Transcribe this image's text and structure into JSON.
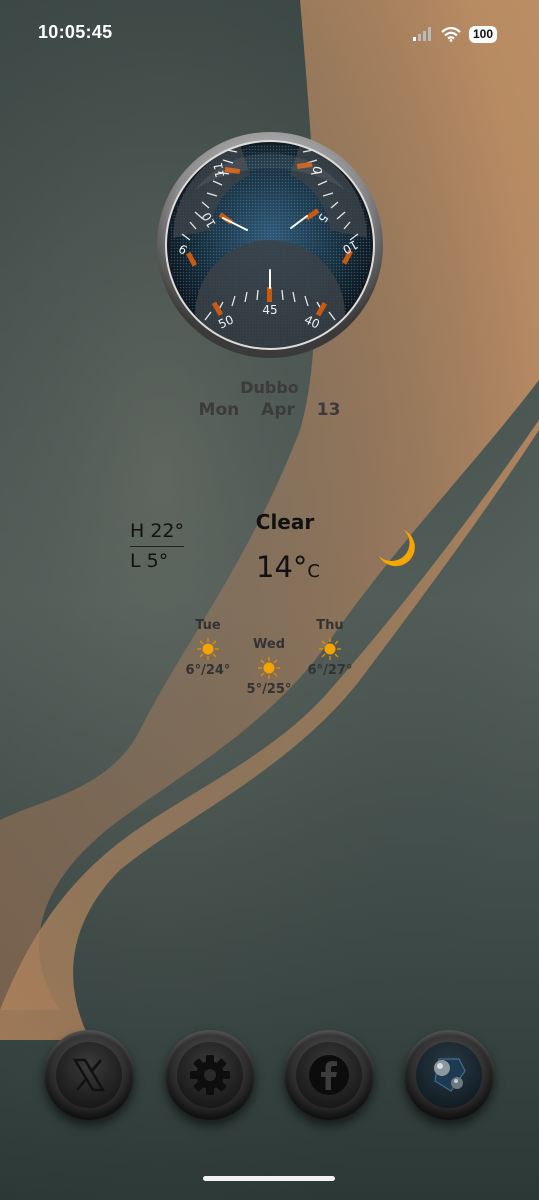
{
  "status_bar": {
    "time": "10:05:45",
    "battery": "100",
    "icons": [
      "signal-icon",
      "wifi-icon",
      "battery-icon"
    ]
  },
  "clock_widget": {
    "scale_top_right": [
      "0",
      "5",
      "10"
    ],
    "scale_top_left": [
      "11",
      "10",
      "9"
    ],
    "scale_bottom": [
      "50",
      "45",
      "40"
    ],
    "accent_color": "#c85a12"
  },
  "location": {
    "city": "Dubbo",
    "weekday": "Mon",
    "month": "Apr",
    "day": "13"
  },
  "weather": {
    "high": "H 22°",
    "low": "L  5°",
    "condition": "Clear",
    "temperature": "14°",
    "unit": "C",
    "icon": "moon-icon",
    "moon_color": "#f5a600"
  },
  "forecast": [
    {
      "day": "Tue",
      "temps": "6°/24°",
      "icon": "sun-icon"
    },
    {
      "day": "Wed",
      "temps": "5°/25°",
      "icon": "sun-icon"
    },
    {
      "day": "Thu",
      "temps": "6°/27°",
      "icon": "sun-icon"
    }
  ],
  "dock": [
    {
      "app": "x-icon"
    },
    {
      "app": "gear-icon"
    },
    {
      "app": "facebook-icon"
    },
    {
      "app": "app-icon"
    }
  ],
  "colors": {
    "wallpaper_dark": "#2f3d3b",
    "wallpaper_sand": "#c48a5c",
    "sun": "#f0a000"
  }
}
